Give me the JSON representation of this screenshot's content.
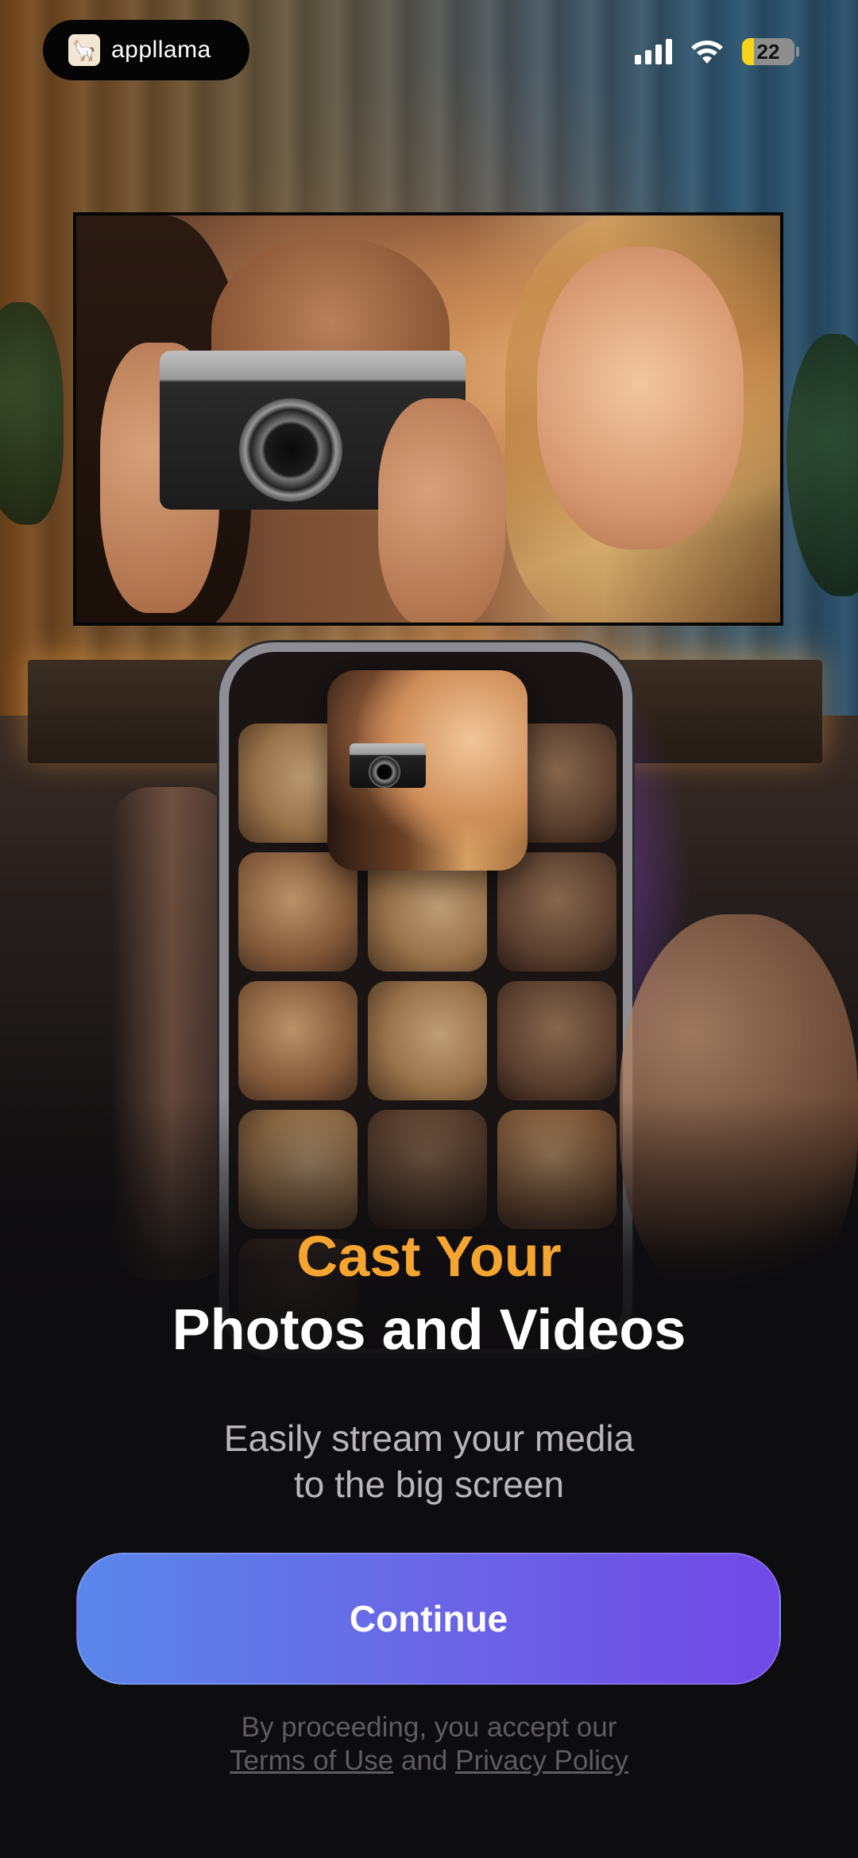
{
  "status_bar": {
    "brand_name": "appllama",
    "battery_level": "22",
    "battery_fraction": 0.22,
    "icons": [
      "cellular-signal-icon",
      "wifi-icon",
      "battery-icon"
    ]
  },
  "hero": {
    "headline_accent": "Cast Your",
    "headline_main": "Photos and Videos",
    "subtitle_line1": "Easily stream your media",
    "subtitle_line2": "to the big screen"
  },
  "actions": {
    "continue_label": "Continue"
  },
  "legal": {
    "prefix": "By proceeding, you accept our",
    "terms_label": "Terms of Use",
    "conjunction": "and",
    "privacy_label": "Privacy Policy"
  },
  "colors": {
    "accent_orange": "#f6a530",
    "button_gradient_start": "#5a86ea",
    "button_gradient_end": "#7049e6",
    "background": "#0d0c0e",
    "battery_yellow": "#f6d41c"
  }
}
